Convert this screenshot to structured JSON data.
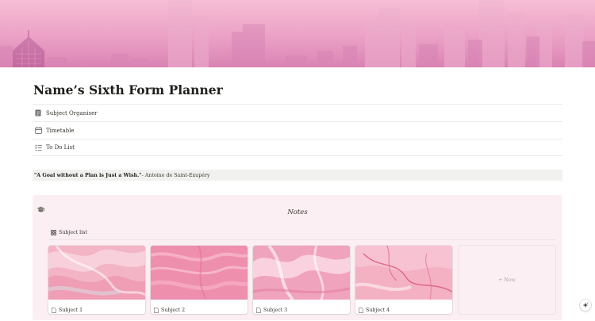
{
  "cover": {
    "name": "pink city skyline cover",
    "colors": [
      "#f4b2cf",
      "#e99bc2",
      "#d983b4",
      "#c46aa2"
    ]
  },
  "page": {
    "title": "Name’s Sixth Form Planner"
  },
  "links": [
    {
      "label": "Subject Organiser",
      "icon": "document-icon"
    },
    {
      "label": "Timetable",
      "icon": "calendar-icon"
    },
    {
      "label": "To Do List",
      "icon": "checklist-icon"
    }
  ],
  "quote": {
    "text": "\"A Goal without a Plan is Just a Wish.\"",
    "author": " - Antoine de Saint-Exupéry"
  },
  "callout": {
    "icon": "graduation-cap-icon",
    "heading": "Notes",
    "view_label": "Subject list",
    "cards": [
      {
        "label": "Subject 1"
      },
      {
        "label": "Subject 2"
      },
      {
        "label": "Subject 3"
      },
      {
        "label": "Subject 4"
      }
    ],
    "new_label": "+ New"
  },
  "colors": {
    "callout_bg": "#fbeff3",
    "quote_bg": "#f1f1ef",
    "text": "#37352f"
  }
}
